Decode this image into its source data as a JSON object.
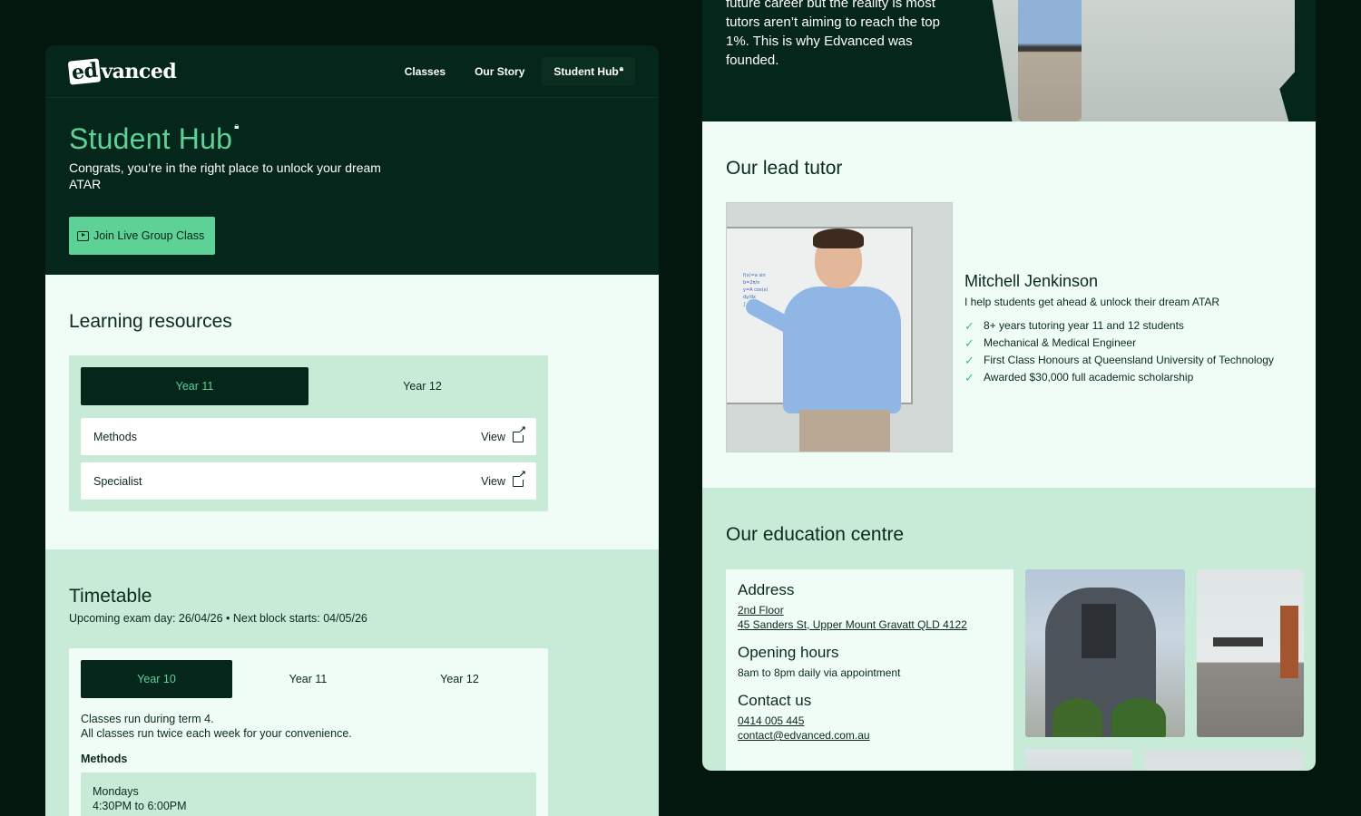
{
  "left": {
    "nav": {
      "logo_prefix": "ed",
      "logo_suffix": "vanced",
      "links": [
        "Classes",
        "Our Story",
        "Student Hub"
      ]
    },
    "hero": {
      "title": "Student Hub",
      "subtitle": "Congrats, you’re in the right place to unlock your dream ATAR",
      "button": "Join Live Group Class"
    },
    "learning": {
      "title": "Learning resources",
      "tabs": [
        "Year 11",
        "Year 12"
      ],
      "rows": [
        {
          "subject": "Methods",
          "action": "View"
        },
        {
          "subject": "Specialist",
          "action": "View"
        }
      ]
    },
    "timetable": {
      "title": "Timetable",
      "subtitle": "Upcoming exam day: 26/04/26 • Next block starts: 04/05/26",
      "tabs": [
        "Year 10",
        "Year 11",
        "Year 12"
      ],
      "line1": "Classes run during term 4.",
      "line2": "All classes run twice each week for your convenience.",
      "subject": "Methods",
      "slot_day": "Mondays",
      "slot_time": "4:30PM to 6:00PM"
    }
  },
  "right": {
    "story": {
      "line1": "future career but the reality is most",
      "line2": "tutors aren’t aiming to reach the top",
      "line3": "1%. This is why Edvanced was",
      "line4": "founded."
    },
    "tutor": {
      "section_title": "Our lead tutor",
      "name": "Mitchell Jenkinson",
      "tagline": "I help students get ahead & unlock their dream ATAR",
      "points": [
        "8+ years tutoring year 11 and 12 students",
        "Mechanical & Medical Engineer",
        "First Class Honours at Queensland University of Technology",
        "Awarded $30,000 full academic scholarship"
      ]
    },
    "centre": {
      "section_title": "Our education centre",
      "address_heading": "Address",
      "address_line1": "2nd Floor",
      "address_line2": "45 Sanders St, Upper Mount Gravatt QLD 4122",
      "hours_heading": "Opening hours",
      "hours": "8am to 8pm daily via appointment",
      "contact_heading": "Contact us",
      "phone": "0414 005 445",
      "email": "contact@edvanced.com.au"
    }
  }
}
